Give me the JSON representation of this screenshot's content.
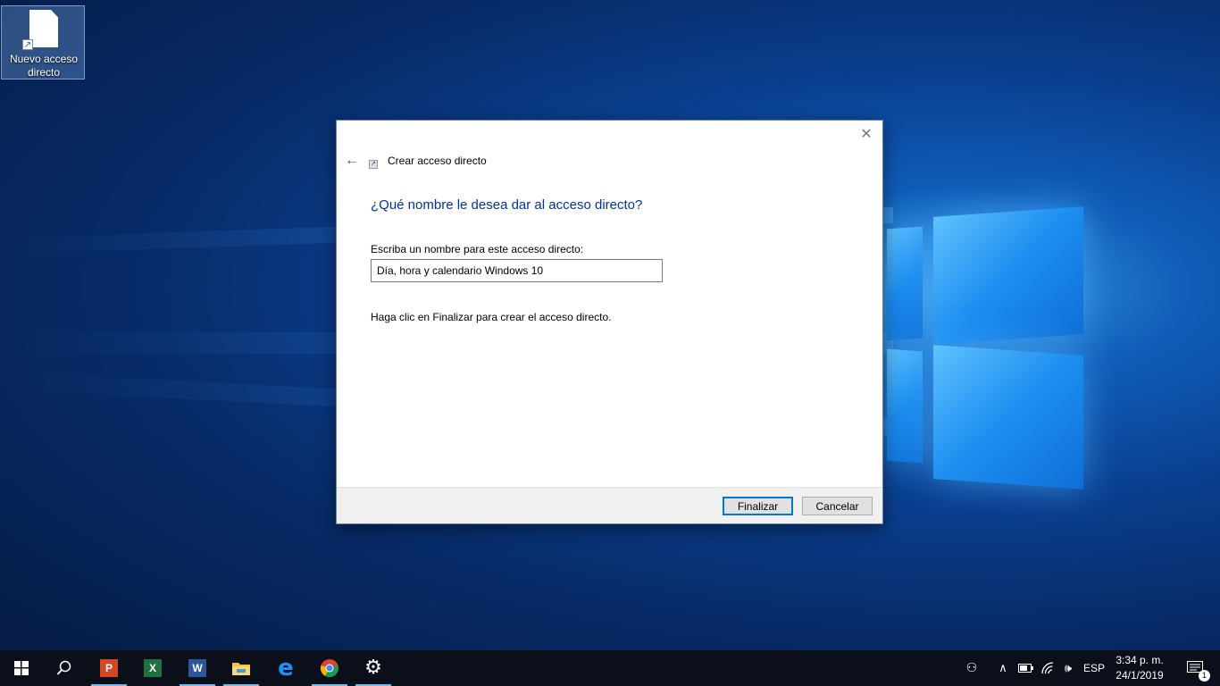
{
  "desktop": {
    "icons": [
      {
        "label": "Nuevo acceso directo",
        "icon": "shortcut-file-icon"
      }
    ]
  },
  "dialog": {
    "title": "Crear acceso directo",
    "close_icon": "close-icon",
    "back_icon": "back-arrow-icon",
    "heading": "¿Qué nombre le desea dar al acceso directo?",
    "field_label": "Escriba un nombre para este acceso directo:",
    "name_value": "Día, hora y calendario Windows 10",
    "hint": "Haga clic en Finalizar para crear el acceso directo.",
    "buttons": {
      "finish": "Finalizar",
      "cancel": "Cancelar"
    },
    "colors": {
      "heading": "#003399",
      "primary_border": "#0078d7"
    }
  },
  "taskbar": {
    "apps": [
      {
        "name": "start",
        "icon": "windows-logo-icon"
      },
      {
        "name": "search",
        "icon": "search-icon"
      },
      {
        "name": "powerpoint",
        "icon": "powerpoint-icon",
        "glyph": "P",
        "color": "#d24726"
      },
      {
        "name": "excel",
        "icon": "excel-icon",
        "glyph": "X",
        "color": "#1e7145"
      },
      {
        "name": "word",
        "icon": "word-icon",
        "glyph": "W",
        "color": "#2b579a"
      },
      {
        "name": "file-explorer",
        "icon": "folder-icon",
        "color": "#f5c342"
      },
      {
        "name": "edge",
        "icon": "edge-icon",
        "glyph": "e",
        "color": "#1e90ff"
      },
      {
        "name": "chrome",
        "icon": "chrome-icon"
      },
      {
        "name": "settings",
        "icon": "gear-icon",
        "glyph": "⚙"
      }
    ],
    "tray": {
      "people_icon": "people-icon",
      "chevron_icon": "chevron-up-icon",
      "battery_icon": "battery-icon",
      "wifi_icon": "wifi-icon",
      "volume_icon": "volume-icon",
      "language": "ESP",
      "time": "3:34 p. m.",
      "date": "24/1/2019",
      "notifications_count": "1"
    }
  }
}
